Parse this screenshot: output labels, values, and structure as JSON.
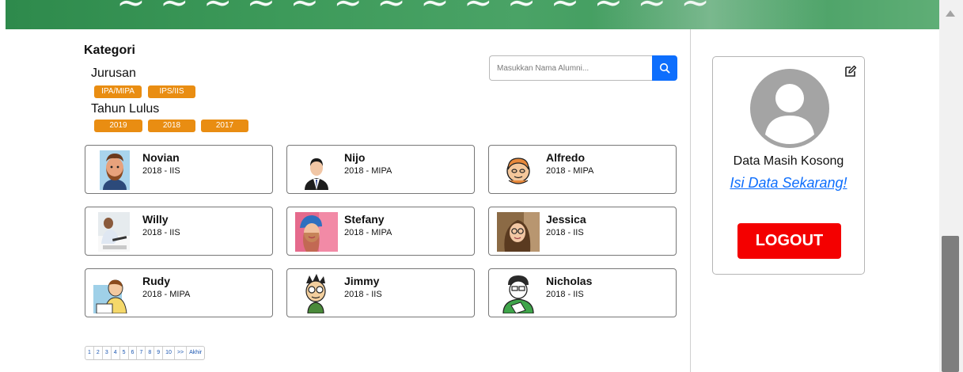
{
  "kategori": {
    "title": "Kategori",
    "jurusan_label": "Jurusan",
    "jurusan_chips": [
      "IPA/MIPA",
      "IPS/IIS"
    ],
    "tahun_label": "Tahun Lulus",
    "tahun_chips": [
      "2019",
      "2018",
      "2017"
    ]
  },
  "search": {
    "placeholder": "Masukkan Nama Alumni...",
    "icon": "search-icon"
  },
  "alumni": [
    {
      "name": "Novian",
      "meta": "2018 - IIS",
      "avatar": "bearded-man-avatar"
    },
    {
      "name": "Nijo",
      "meta": "2018 - MIPA",
      "avatar": "businessman-avatar"
    },
    {
      "name": "Alfredo",
      "meta": "2018 - MIPA",
      "avatar": "cartoon-face-avatar"
    },
    {
      "name": "Willy",
      "meta": "2018 - IIS",
      "avatar": "studying-man-photo"
    },
    {
      "name": "Stefany",
      "meta": "2018 - MIPA",
      "avatar": "woman-beanie-photo"
    },
    {
      "name": "Jessica",
      "meta": "2018 - IIS",
      "avatar": "woman-glasses-photo"
    },
    {
      "name": "Rudy",
      "meta": "2018 - MIPA",
      "avatar": "cartoon-man-desk"
    },
    {
      "name": "Jimmy",
      "meta": "2018 - IIS",
      "avatar": "cartoon-boy-glasses"
    },
    {
      "name": "Nicholas",
      "meta": "2018 - IIS",
      "avatar": "sketch-boy-avatar"
    }
  ],
  "pagination": [
    "1",
    "2",
    "3",
    "4",
    "5",
    "6",
    "7",
    "8",
    "9",
    "10",
    ">>",
    "Akhir"
  ],
  "profile": {
    "empty_text": "Data Masih Kosong",
    "fill_link": "Isi Data Sekarang!",
    "logout_label": "LOGOUT",
    "edit_icon": "edit-icon",
    "avatar_icon": "user-placeholder-icon"
  },
  "colors": {
    "chip": "#e98d12",
    "search_button": "#0d6efd",
    "link": "#0d6efd",
    "logout": "#f40000",
    "banner": "#3d9a5a"
  }
}
